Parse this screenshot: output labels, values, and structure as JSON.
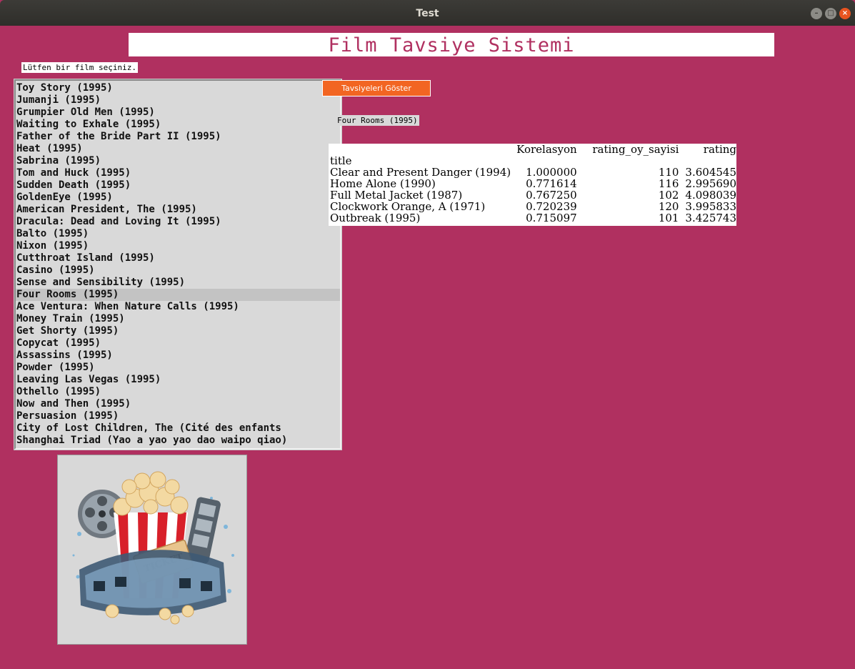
{
  "window": {
    "title": "Test"
  },
  "header": {
    "title": "Film Tavsiye Sistemi"
  },
  "prompt": {
    "label": "Lütfen bir film seçiniz."
  },
  "movie_list": {
    "items": [
      "Toy Story (1995)",
      "Jumanji (1995)",
      "Grumpier Old Men (1995)",
      "Waiting to Exhale (1995)",
      "Father of the Bride Part II (1995)",
      "Heat (1995)",
      "Sabrina (1995)",
      "Tom and Huck (1995)",
      "Sudden Death (1995)",
      "GoldenEye (1995)",
      "American President, The (1995)",
      "Dracula: Dead and Loving It (1995)",
      "Balto (1995)",
      "Nixon (1995)",
      "Cutthroat Island (1995)",
      "Casino (1995)",
      "Sense and Sensibility (1995)",
      "Four Rooms (1995)",
      "Ace Ventura: When Nature Calls (1995)",
      "Money Train (1995)",
      "Get Shorty (1995)",
      "Copycat (1995)",
      "Assassins (1995)",
      "Powder (1995)",
      "Leaving Las Vegas (1995)",
      "Othello (1995)",
      "Now and Then (1995)",
      "Persuasion (1995)",
      "City of Lost Children, The (Cité des enfants",
      "Shanghai Triad (Yao a yao yao dao waipo qiao)"
    ],
    "selected_index": 17
  },
  "actions": {
    "show_button_label": "Tavsiyeleri Göster"
  },
  "selected_movie": {
    "label": "Four Rooms (1995)"
  },
  "results": {
    "columns": [
      "Korelasyon",
      "rating_oy_sayisi",
      "rating"
    ],
    "index_name": "title",
    "rows": [
      {
        "title": "Clear and Present Danger (1994)",
        "korelasyon": "1.000000",
        "rating_oy_sayisi": "110",
        "rating": "3.604545"
      },
      {
        "title": "Home Alone (1990)",
        "korelasyon": "0.771614",
        "rating_oy_sayisi": "116",
        "rating": "2.995690"
      },
      {
        "title": "Full Metal Jacket (1987)",
        "korelasyon": "0.767250",
        "rating_oy_sayisi": "102",
        "rating": "4.098039"
      },
      {
        "title": "Clockwork Orange, A (1971)",
        "korelasyon": "0.720239",
        "rating_oy_sayisi": "120",
        "rating": "3.995833"
      },
      {
        "title": "Outbreak (1995)",
        "korelasyon": "0.715097",
        "rating_oy_sayisi": "101",
        "rating": "3.425743"
      }
    ]
  },
  "colors": {
    "background": "#b03060",
    "accent": "#f26522",
    "title_text": "#b03060"
  },
  "image": {
    "icon": "popcorn-film-reel-ticket-icon"
  }
}
